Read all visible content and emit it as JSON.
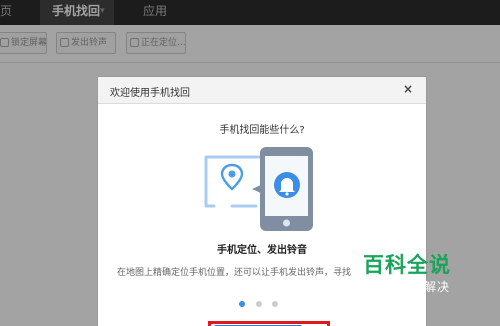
{
  "topbar": {
    "tabs": [
      {
        "label": "页"
      },
      {
        "label": "手机找回"
      },
      {
        "label": "应用"
      }
    ]
  },
  "toolbar": {
    "lock_label": "锁定屏幕",
    "ring_label": "发出铃声",
    "locate_label": "正在定位..."
  },
  "dialog": {
    "title": "欢迎使用手机找回",
    "close": "×",
    "question": "手机找回能些什么?",
    "feature_title": "手机定位、发出铃音",
    "feature_desc": "在地图上精确定位手机位置，还可以让手机发出铃声，寻找",
    "carousel": {
      "current": 1,
      "total": 3
    }
  },
  "watermark": {
    "title": "百科全说",
    "subtitle": "助你轻松解决"
  },
  "colors": {
    "accent": "#3a8ee6",
    "highlight_border": "#e0191f",
    "watermark_green": "#1aa35a"
  }
}
